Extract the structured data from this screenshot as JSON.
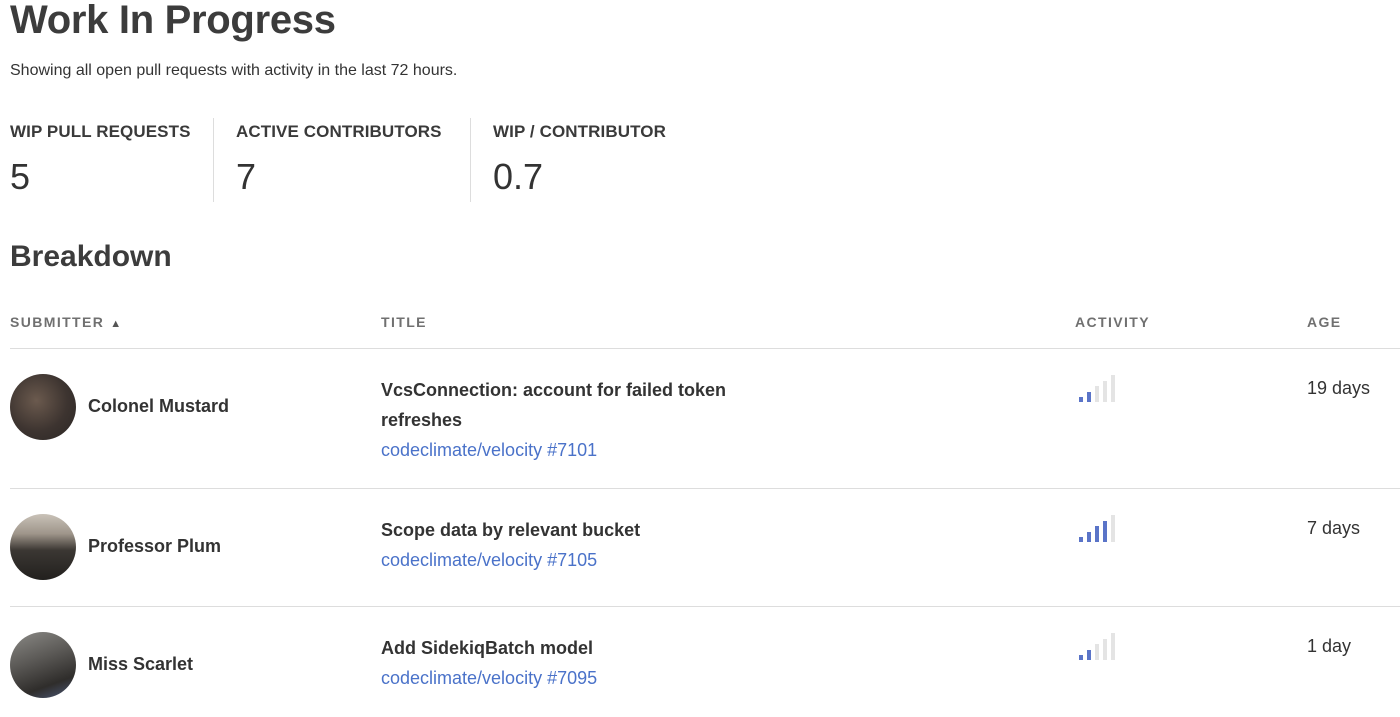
{
  "page": {
    "title": "Work In Progress",
    "subtitle": "Showing all open pull requests with activity in the last 72 hours."
  },
  "stats": [
    {
      "label": "WIP PULL REQUESTS",
      "value": "5"
    },
    {
      "label": "ACTIVE CONTRIBUTORS",
      "value": "7"
    },
    {
      "label": "WIP / CONTRIBUTOR",
      "value": "0.7"
    }
  ],
  "breakdown": {
    "title": "Breakdown",
    "columns": {
      "submitter": "SUBMITTER",
      "title": "TITLE",
      "activity": "ACTIVITY",
      "age": "AGE"
    },
    "sort": {
      "column": "submitter",
      "direction": "ascending",
      "icon": "caret-up-icon"
    },
    "rows": [
      {
        "submitter": "Colonel Mustard",
        "title": "VcsConnection: account for failed token refreshes",
        "link": "codeclimate/velocity #7101",
        "activity_level": 2,
        "activity_max": 5,
        "age": "19 days"
      },
      {
        "submitter": "Professor Plum",
        "title": "Scope data by relevant bucket",
        "link": "codeclimate/velocity #7105",
        "activity_level": 4,
        "activity_max": 5,
        "age": "7 days"
      },
      {
        "submitter": "Miss Scarlet",
        "title": "Add SidekiqBatch model",
        "link": "codeclimate/velocity #7095",
        "activity_level": 2,
        "activity_max": 5,
        "age": "1 day"
      }
    ]
  },
  "colors": {
    "link": "#4a72c9",
    "activity_on": "#5a74c8",
    "activity_off": "#e4e4e4",
    "divider": "#dddddd"
  }
}
